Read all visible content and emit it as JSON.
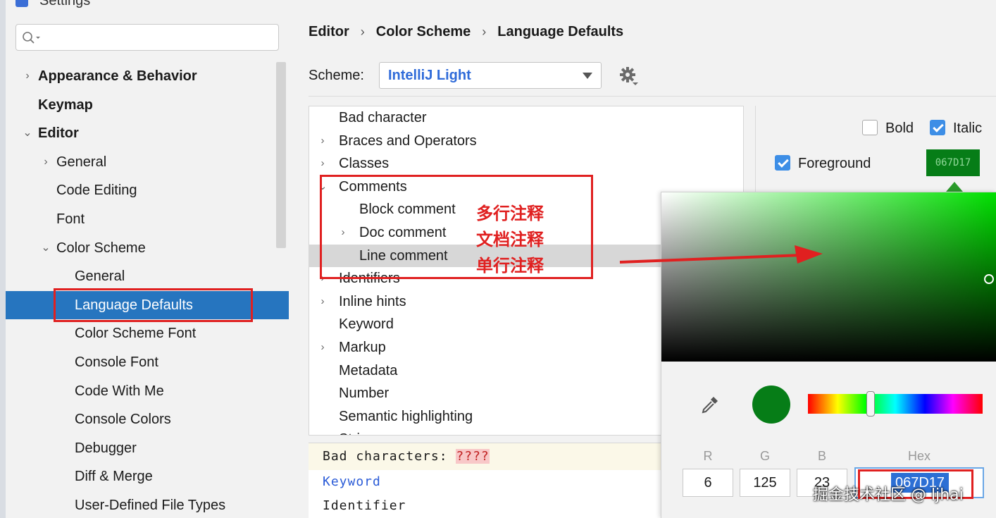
{
  "window": {
    "title": "Settings"
  },
  "search": {
    "placeholder": ""
  },
  "sidebar": {
    "items": [
      {
        "label": "Appearance & Behavior",
        "arrow": "›",
        "bold": true
      },
      {
        "label": "Keymap",
        "arrow": "",
        "bold": true
      },
      {
        "label": "Editor",
        "arrow": "⌄",
        "bold": true
      },
      {
        "label": "General",
        "arrow": "›",
        "bold": false
      },
      {
        "label": "Code Editing",
        "arrow": "",
        "bold": false
      },
      {
        "label": "Font",
        "arrow": "",
        "bold": false
      },
      {
        "label": "Color Scheme",
        "arrow": "⌄",
        "bold": false
      },
      {
        "label": "General",
        "arrow": "",
        "bold": false
      },
      {
        "label": "Language Defaults",
        "arrow": "",
        "bold": false,
        "selected": true
      },
      {
        "label": "Color Scheme Font",
        "arrow": "",
        "bold": false
      },
      {
        "label": "Console Font",
        "arrow": "",
        "bold": false
      },
      {
        "label": "Code With Me",
        "arrow": "",
        "bold": false
      },
      {
        "label": "Console Colors",
        "arrow": "",
        "bold": false
      },
      {
        "label": "Debugger",
        "arrow": "",
        "bold": false
      },
      {
        "label": "Diff & Merge",
        "arrow": "",
        "bold": false
      },
      {
        "label": "User-Defined File Types",
        "arrow": "",
        "bold": false
      }
    ]
  },
  "breadcrumb": [
    "Editor",
    "Color Scheme",
    "Language Defaults"
  ],
  "breadcrumb_separator": "›",
  "scheme": {
    "label": "Scheme:",
    "value": "IntelliJ Light"
  },
  "tree": {
    "items": [
      {
        "label": "Bad character",
        "arrow": ""
      },
      {
        "label": "Braces and Operators",
        "arrow": "›"
      },
      {
        "label": "Classes",
        "arrow": "›"
      },
      {
        "label": "Comments",
        "arrow": "⌄"
      },
      {
        "label": "Block comment",
        "arrow": ""
      },
      {
        "label": "Doc comment",
        "arrow": "›"
      },
      {
        "label": "Line comment",
        "arrow": "",
        "highlight": true
      },
      {
        "label": "Identifiers",
        "arrow": "›"
      },
      {
        "label": "Inline hints",
        "arrow": "›"
      },
      {
        "label": "Keyword",
        "arrow": ""
      },
      {
        "label": "Markup",
        "arrow": "›"
      },
      {
        "label": "Metadata",
        "arrow": ""
      },
      {
        "label": "Number",
        "arrow": ""
      },
      {
        "label": "Semantic highlighting",
        "arrow": ""
      },
      {
        "label": "Strin",
        "arrow": "›"
      }
    ]
  },
  "preview": {
    "line1_prefix": "Bad characters: ",
    "line1_bad": "????",
    "line2": "Keyword",
    "line3": "Identifier"
  },
  "options": {
    "bold_label": "Bold",
    "bold_checked": false,
    "italic_label": "Italic",
    "italic_checked": true,
    "foreground_label": "Foreground",
    "foreground_checked": true,
    "foreground_hex": "067D17"
  },
  "picker": {
    "r_label": "R",
    "r": "6",
    "g_label": "G",
    "g": "125",
    "b_label": "B",
    "b": "23",
    "hex_label": "Hex",
    "hex": "067D17",
    "color": "#067d17"
  },
  "annotations": {
    "block": "多行注释",
    "doc": "文档注释",
    "line": "单行注释"
  },
  "watermark": "掘金技术社区 @ ljhai"
}
